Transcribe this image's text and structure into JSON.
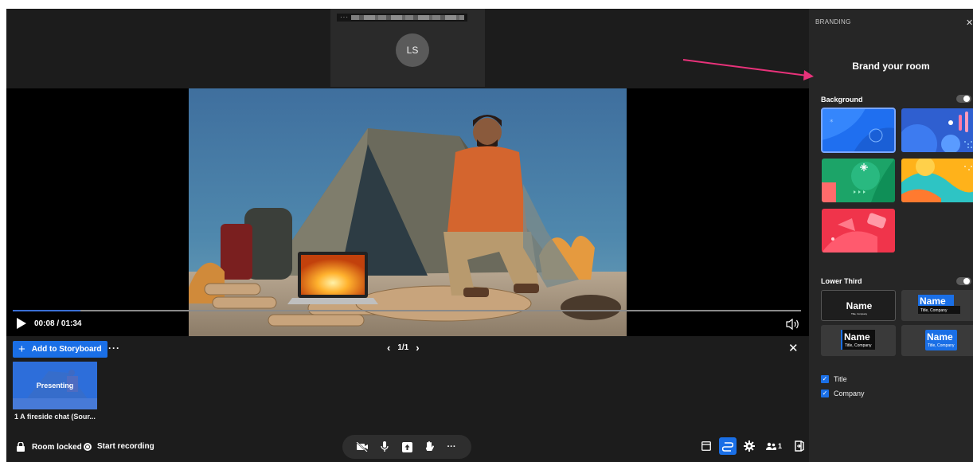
{
  "participant": {
    "menu_dots": "···",
    "initials": "LS"
  },
  "player": {
    "progress": 0.086,
    "time": "00:08 / 01:34"
  },
  "storyboard": {
    "add_label": "Add to Storyboard",
    "more": "···",
    "page": "1/1",
    "items": [
      {
        "status": "Presenting",
        "caption": "1 A fireside chat (Sour..."
      }
    ]
  },
  "bottom_bar": {
    "room_locked": "Room locked",
    "start_recording": "Start recording",
    "more": "···",
    "participant_count": "1"
  },
  "branding": {
    "header": "BRANDING",
    "title": "Brand your room",
    "background_label": "Background",
    "background_enabled": false,
    "lower_third_label": "Lower Third",
    "lower_third_enabled": false,
    "lower_thirds": [
      {
        "name": "Name",
        "sub": "Title, Company"
      },
      {
        "name": "Name",
        "sub": "Title, Company"
      },
      {
        "name": "Name",
        "sub": "Title, Company"
      },
      {
        "name": "Name",
        "sub": "Title, Company"
      }
    ],
    "options": [
      {
        "label": "Title",
        "checked": true
      },
      {
        "label": "Company",
        "checked": true
      }
    ]
  },
  "colors": {
    "accent": "#1a6fe6",
    "annotation_arrow": "#e8327a"
  }
}
